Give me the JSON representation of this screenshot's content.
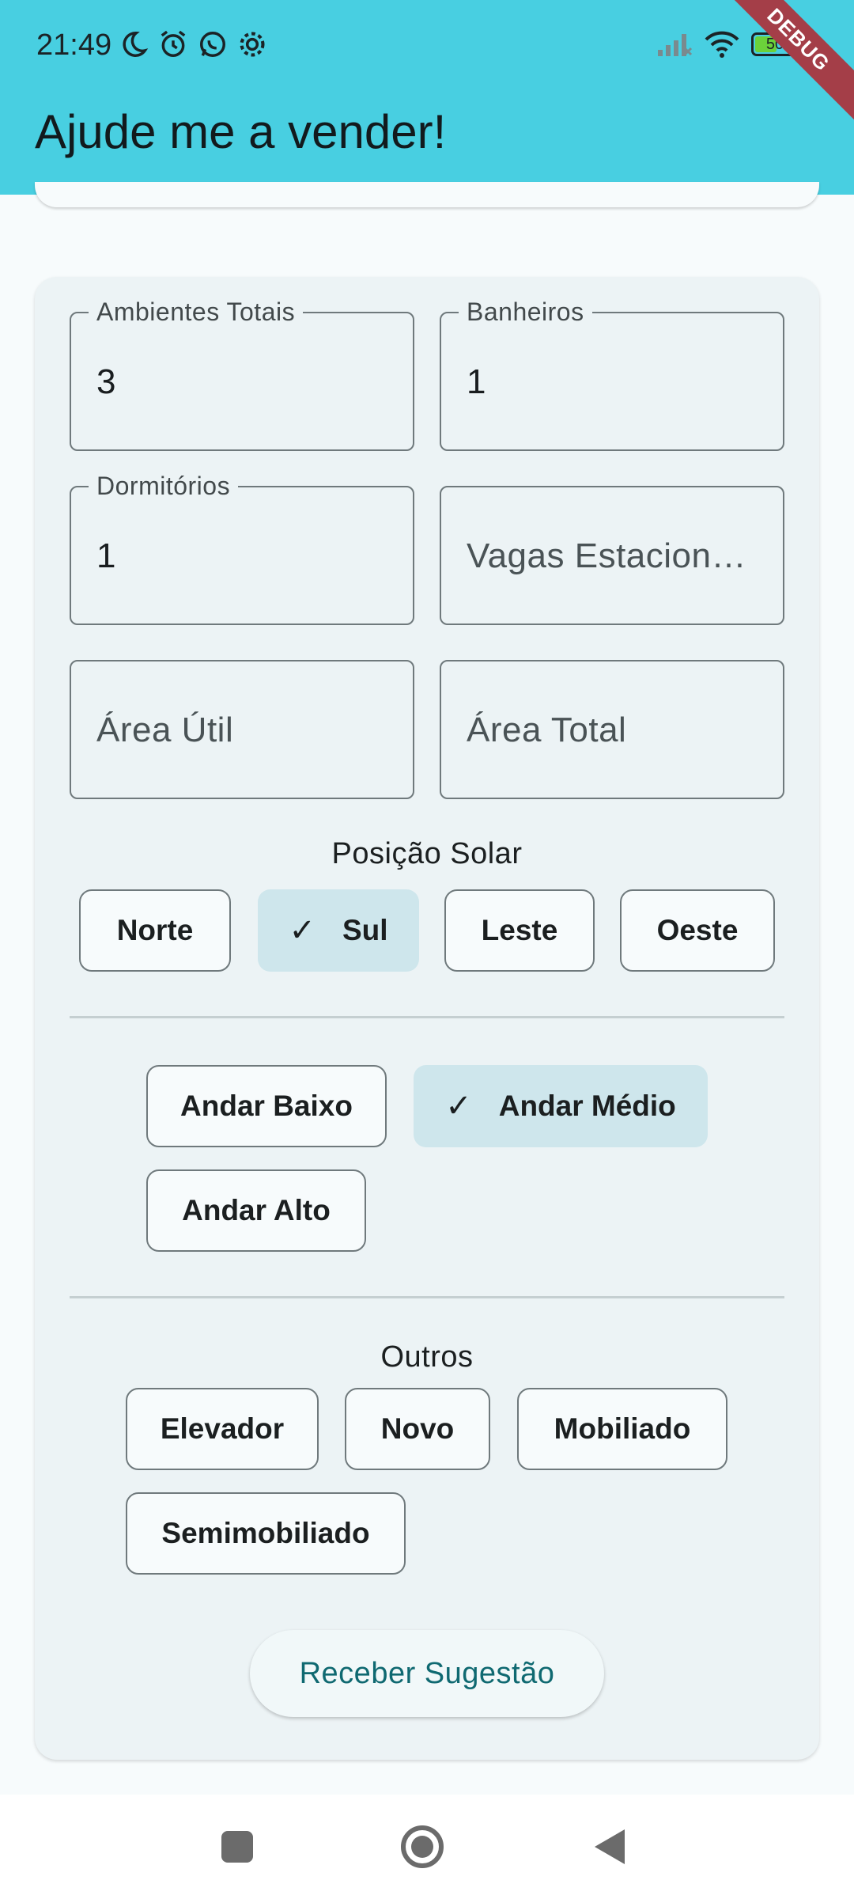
{
  "status_bar": {
    "time": "21:49",
    "left_icons": [
      "moon-icon",
      "alarm-icon",
      "whatsapp-icon",
      "settings-icon"
    ],
    "right_icons": [
      "signal-icon",
      "wifi-icon",
      "battery-icon"
    ],
    "battery_level": "50"
  },
  "debug_banner": "DEBUG",
  "app_bar": {
    "title": "Ajude me a vender!"
  },
  "form": {
    "ambientes_totais": {
      "label": "Ambientes Totais",
      "value": "3"
    },
    "banheiros": {
      "label": "Banheiros",
      "value": "1"
    },
    "dormitorios": {
      "label": "Dormitórios",
      "value": "1"
    },
    "vagas": {
      "placeholder": "Vagas Estacionamento"
    },
    "area_util": {
      "placeholder": "Área Útil"
    },
    "area_total": {
      "placeholder": "Área Total"
    }
  },
  "posicao_solar": {
    "title": "Posição Solar",
    "options": [
      {
        "label": "Norte",
        "selected": false
      },
      {
        "label": "Sul",
        "selected": true
      },
      {
        "label": "Leste",
        "selected": false
      },
      {
        "label": "Oeste",
        "selected": false
      }
    ]
  },
  "andar": {
    "options": [
      {
        "label": "Andar Baixo",
        "selected": false
      },
      {
        "label": "Andar Médio",
        "selected": true
      },
      {
        "label": "Andar Alto",
        "selected": false
      }
    ]
  },
  "outros": {
    "title": "Outros",
    "options": [
      {
        "label": "Elevador",
        "selected": false
      },
      {
        "label": "Novo",
        "selected": false
      },
      {
        "label": "Mobiliado",
        "selected": false
      },
      {
        "label": "Semimobiliado",
        "selected": false
      }
    ]
  },
  "submit": {
    "label": "Receber Sugestão"
  },
  "colors": {
    "app_bar": "#48cfe1",
    "chip_selected": "#cee6ec",
    "card": "#ecf3f5",
    "button_text": "#0f6971",
    "debug_ribbon": "#a43e48"
  },
  "nav_bar": {
    "buttons": [
      "recent-apps-icon",
      "home-icon",
      "back-icon"
    ]
  }
}
